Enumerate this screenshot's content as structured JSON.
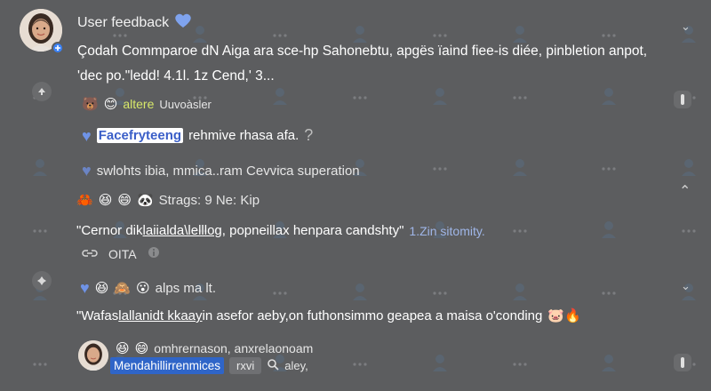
{
  "header": {
    "title": "User feedback",
    "post_text": "Çodah Commparoe dN Aiga ara sce-hp Sahonebtu, apgës ïaind fiee-is diée, pinbletion anpot, 'dec po.\"ledd! 4.1l. 1z Cend,'  3..."
  },
  "thread": {
    "reaction_row_1": {
      "label": "altere",
      "sub": "Uuvoàsler"
    },
    "reply_1": {
      "highlighted": "Facefryteeng",
      "text": "rehmive rhasa afa.",
      "suffix": "?"
    },
    "reply_2": {
      "text": "swlohts ibia, mmica..ram Cevvica superation"
    },
    "comment_1": {
      "meta": "Strags: 9 Ne: Kip",
      "text_prefix": "\"Cernor dik ",
      "text_underlined": "laiialda\\lelllog",
      "text_suffix": ", popneillax henpara candshty\"",
      "link": "1.Zin sitomity.",
      "action_label": "OITA"
    },
    "comment_2": {
      "meta": "alps ma lt.",
      "text_prefix": "\"Wafas ",
      "text_underlined": "lallanidt kkaay",
      "text_suffix": " in asefor aeby,on futhonsimmo geapea a maisa o'conding"
    },
    "reply_box": {
      "line_1": "omhrernason, anxrelaonoam",
      "mention": "Mendahillirrenmices",
      "field_1": "rxvi",
      "field_2": "aley,"
    }
  },
  "icons": {
    "title_icon": "blue-heart-icon",
    "collapse": "chevron-icon",
    "more": "more-dots-icon"
  },
  "colors": {
    "background": "#5c5d5f",
    "heart_blue": "#6f93e6",
    "mention_blue": "#2f65c8",
    "link_blue": "#9fb6e8",
    "label_yellow": "#d7e86a"
  }
}
